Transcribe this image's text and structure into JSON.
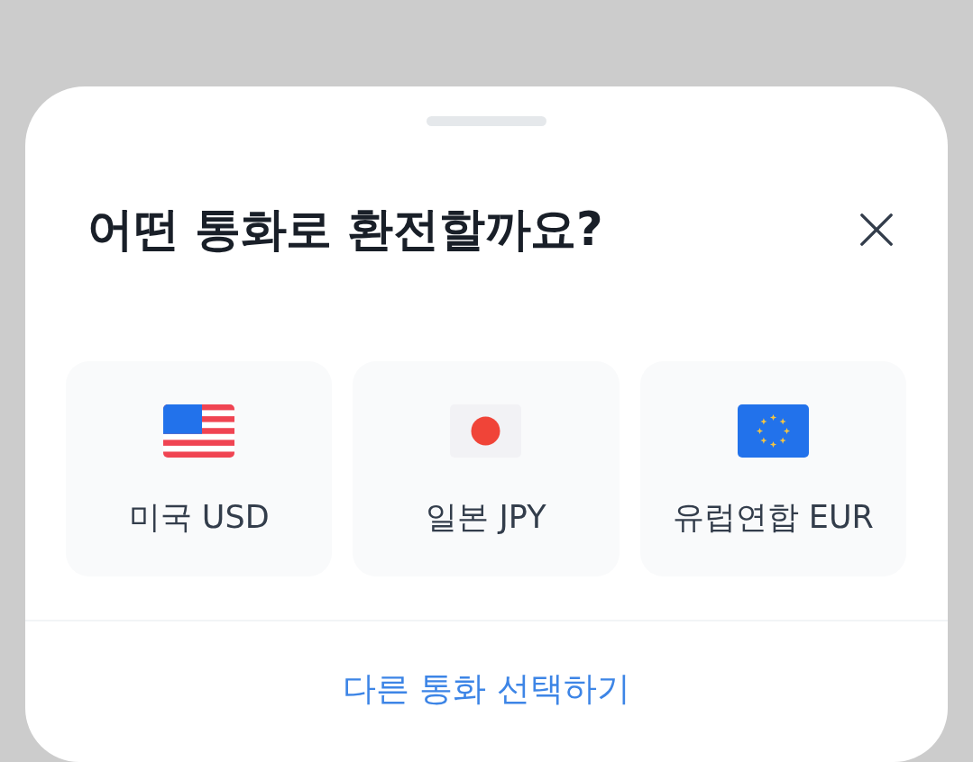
{
  "sheet": {
    "title": "어떤 통화로 환전할까요?"
  },
  "currencies": [
    {
      "label": "미국 USD",
      "kind": "us"
    },
    {
      "label": "일본 JPY",
      "kind": "jp"
    },
    {
      "label": "유럽연합 EUR",
      "kind": "eu"
    }
  ],
  "footer": {
    "link": "다른 통화 선택하기"
  }
}
